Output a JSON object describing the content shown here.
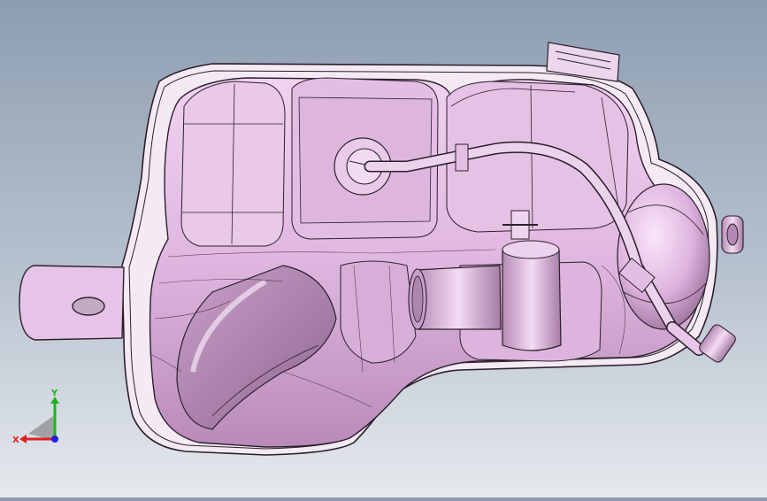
{
  "viewport": {
    "background_top": "#8d9db1",
    "background_bottom": "#e6e9ee",
    "part_color": "#e6bfe6",
    "edge_color": "#3a2a3a",
    "model": "coolant-expansion-tank"
  },
  "triad": {
    "x_label": "X",
    "y_label": "Y",
    "x_color": "#e02020",
    "y_color": "#20b020",
    "z_color": "#2020e0"
  }
}
